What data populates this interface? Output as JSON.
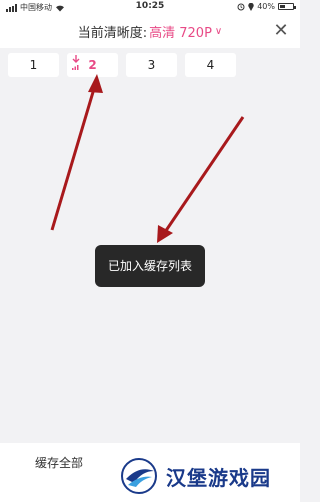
{
  "status_bar": {
    "carrier": "中国移动",
    "time": "10:25",
    "battery": "40%",
    "battery_level": 0.4
  },
  "header": {
    "label": "当前清晰度:",
    "quality": "高清 720P",
    "chevron": "chevron-down-icon"
  },
  "episodes": [
    {
      "label": "1",
      "state": "idle"
    },
    {
      "label": "2",
      "state": "downloading"
    },
    {
      "label": "3",
      "state": "idle"
    },
    {
      "label": "4",
      "state": "idle"
    }
  ],
  "toast": {
    "text": "已加入缓存列表"
  },
  "bottom": {
    "save_all": "缓存全部"
  },
  "watermark": {
    "text": "汉堡游戏园"
  },
  "colors": {
    "accent": "#e84a86",
    "arrow": "#a8191c",
    "toast_bg": "#121212",
    "watermark_text": "#1a3a8a"
  }
}
